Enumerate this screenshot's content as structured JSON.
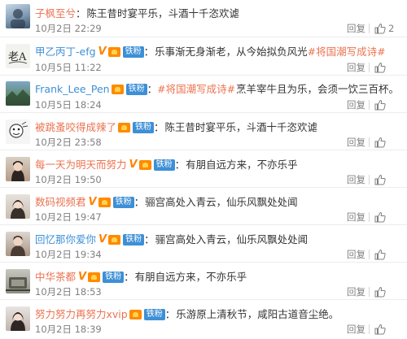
{
  "colors": {
    "name_orange": "#eb7350",
    "name_blue": "#3d8fd6",
    "meta_gray": "#808080",
    "fan_badge": "#3d8fd6"
  },
  "icons": {
    "like": "thumbs-up-icon",
    "vip": "v-badge-icon",
    "level": "crown-icon"
  },
  "comments": [
    {
      "username": "子枫至兮",
      "text": "陈王昔时宴平乐，斗酒十千恣欢谑",
      "time": "10月2日 22:29",
      "reply": "回复",
      "likes": "2"
    },
    {
      "username": "甲乙丙丁-efg",
      "vip": "V",
      "fan": "铁粉",
      "text": "乐事渐无身渐老，从今始拟负风光",
      "topic": "#将国潮写成诗#",
      "time": "10月5日 11:22",
      "reply": "回复",
      "likes": ""
    },
    {
      "username": "Frank_Lee_Pen",
      "fan": "铁粉",
      "topic": "#将国潮写成诗#",
      "text": "烹羊宰牛且为乐，会须一饮三百杯。",
      "time": "10月5日 18:24",
      "reply": "回复",
      "likes": ""
    },
    {
      "username": "被跳蚤咬得成辣了",
      "fan": "铁粉",
      "text": "陈王昔时宴平乐，斗酒十千恣欢谑",
      "time": "10月2日 23:58",
      "reply": "回复",
      "likes": ""
    },
    {
      "username": "每一天为明天而努力",
      "vip": "V",
      "fan": "铁粉",
      "text": "有朋自远方来，不亦乐乎",
      "time": "10月2日 19:50",
      "reply": "回复",
      "likes": ""
    },
    {
      "username": "数码视频君",
      "vip": "V",
      "fan": "铁粉",
      "text": "骊宫高处入青云，仙乐风飘处处闻",
      "time": "10月2日 19:47",
      "reply": "回复",
      "likes": ""
    },
    {
      "username": "回忆那你爱你",
      "vip": "V",
      "fan": "铁粉",
      "text": "骊宫高处入青云，仙乐风飘处处闻",
      "time": "10月2日 19:34",
      "reply": "回复",
      "likes": ""
    },
    {
      "username": "中华茶都",
      "vip": "V",
      "fan": "铁粉",
      "text": "有朋自远方来，不亦乐乎",
      "time": "10月2日 18:53",
      "reply": "回复",
      "likes": ""
    },
    {
      "username": "努力努力再努力xvip",
      "fan": "铁粉",
      "text": "乐游原上清秋节，咸阳古道音尘绝。",
      "time": "10月2日 18:39",
      "reply": "回复",
      "likes": ""
    }
  ]
}
